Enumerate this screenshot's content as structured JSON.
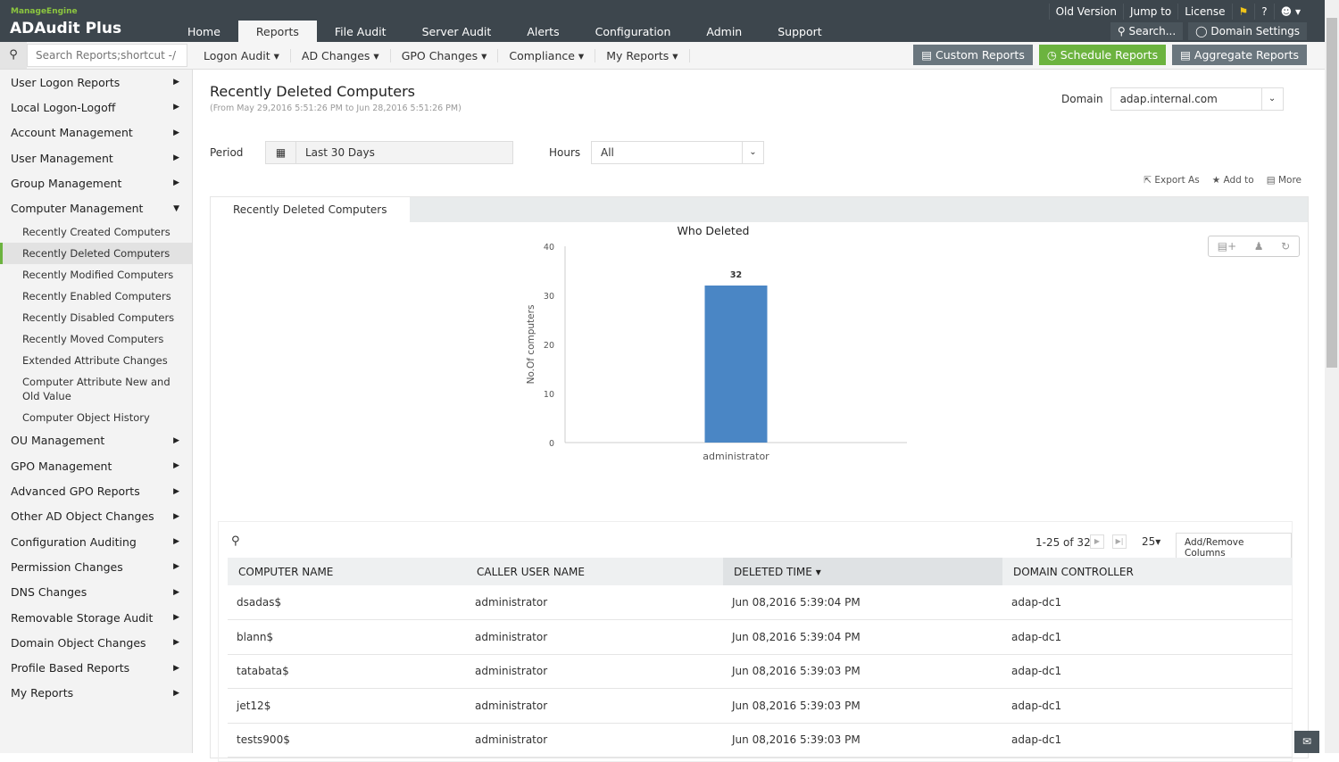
{
  "brand": {
    "vendor": "ManageEngine",
    "product": "ADAudit Plus"
  },
  "nav": {
    "tabs": [
      "Home",
      "Reports",
      "File Audit",
      "Server Audit",
      "Alerts",
      "Configuration",
      "Admin",
      "Support"
    ],
    "active": "Reports",
    "links": [
      "Old Version",
      "Jump to",
      "License"
    ],
    "search_label": "Search...",
    "domain_settings": "Domain Settings"
  },
  "subnav": {
    "search_placeholder": "Search Reports;shortcut -/",
    "menus": [
      "Logon Audit",
      "AD Changes",
      "GPO Changes",
      "Compliance",
      "My Reports"
    ],
    "buttons": {
      "custom": "Custom Reports",
      "schedule": "Schedule Reports",
      "aggregate": "Aggregate Reports"
    }
  },
  "sidebar": {
    "items_top": [
      "User Logon Reports",
      "Local Logon-Logoff",
      "Account Management",
      "User Management",
      "Group Management",
      "Computer Management"
    ],
    "sub_items": [
      "Recently Created Computers",
      "Recently Deleted Computers",
      "Recently Modified Computers",
      "Recently Enabled Computers",
      "Recently Disabled Computers",
      "Recently Moved Computers",
      "Extended Attribute Changes",
      "Computer Attribute New and Old Value",
      "Computer Object History"
    ],
    "active_sub": "Recently Deleted Computers",
    "items_bottom": [
      "OU Management",
      "GPO Management",
      "Advanced GPO Reports",
      "Other AD Object Changes",
      "Configuration Auditing",
      "Permission Changes",
      "DNS Changes",
      "Removable Storage Audit",
      "Domain Object Changes",
      "Profile Based Reports",
      "My Reports"
    ]
  },
  "report": {
    "title": "Recently Deleted Computers",
    "range": "(From May 29,2016 5:51:26 PM to Jun 28,2016 5:51:26 PM)",
    "domain_label": "Domain",
    "domain_value": "adap.internal.com",
    "period_label": "Period",
    "period_value": "Last 30 Days",
    "hours_label": "Hours",
    "hours_value": "All",
    "actions": [
      "Export As",
      "Add to",
      "More"
    ],
    "tab": "Recently Deleted Computers"
  },
  "chart_data": {
    "type": "bar",
    "title": "Who Deleted",
    "ylabel": "No.Of computers",
    "xlabel": "",
    "categories": [
      "administrator"
    ],
    "values": [
      32
    ],
    "ylim": [
      0,
      40
    ],
    "yticks": [
      0,
      10,
      20,
      30,
      40
    ],
    "color": "#4a86c5",
    "data_labels": true
  },
  "table": {
    "pagination": "1-25 of 32",
    "page_size": "25",
    "add_remove": "Add/Remove Columns",
    "columns": [
      "COMPUTER NAME",
      "CALLER USER NAME",
      "DELETED TIME",
      "DOMAIN CONTROLLER"
    ],
    "sorted_column": "DELETED TIME",
    "rows": [
      [
        "dsadas$",
        "administrator",
        "Jun 08,2016 5:39:04 PM",
        "adap-dc1"
      ],
      [
        "blann$",
        "administrator",
        "Jun 08,2016 5:39:04 PM",
        "adap-dc1"
      ],
      [
        "tatabata$",
        "administrator",
        "Jun 08,2016 5:39:03 PM",
        "adap-dc1"
      ],
      [
        "jet12$",
        "administrator",
        "Jun 08,2016 5:39:03 PM",
        "adap-dc1"
      ],
      [
        "tests900$",
        "administrator",
        "Jun 08,2016 5:39:03 PM",
        "adap-dc1"
      ]
    ]
  }
}
